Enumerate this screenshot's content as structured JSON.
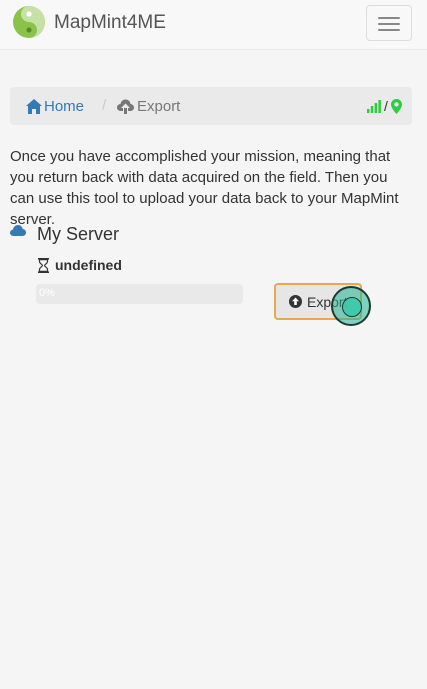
{
  "navbar": {
    "brand": "MapMint4ME"
  },
  "breadcrumb": {
    "home": "Home",
    "separator": "/",
    "current": "Export",
    "status_separator": "/"
  },
  "intro": {
    "text": "Once you have accomplished your mission, meaning that you return back with data acquired on the field. Then you can use this tool to upload your data back to your MapMint server."
  },
  "server": {
    "title": "My Server",
    "status": "undefined",
    "progress_label": "0%",
    "progress": 0,
    "export_label": "Export"
  },
  "colors": {
    "link": "#337ab7",
    "status_green": "#2ecc40",
    "button_border": "#e7a94f",
    "logo_green": "#8bc34a"
  }
}
